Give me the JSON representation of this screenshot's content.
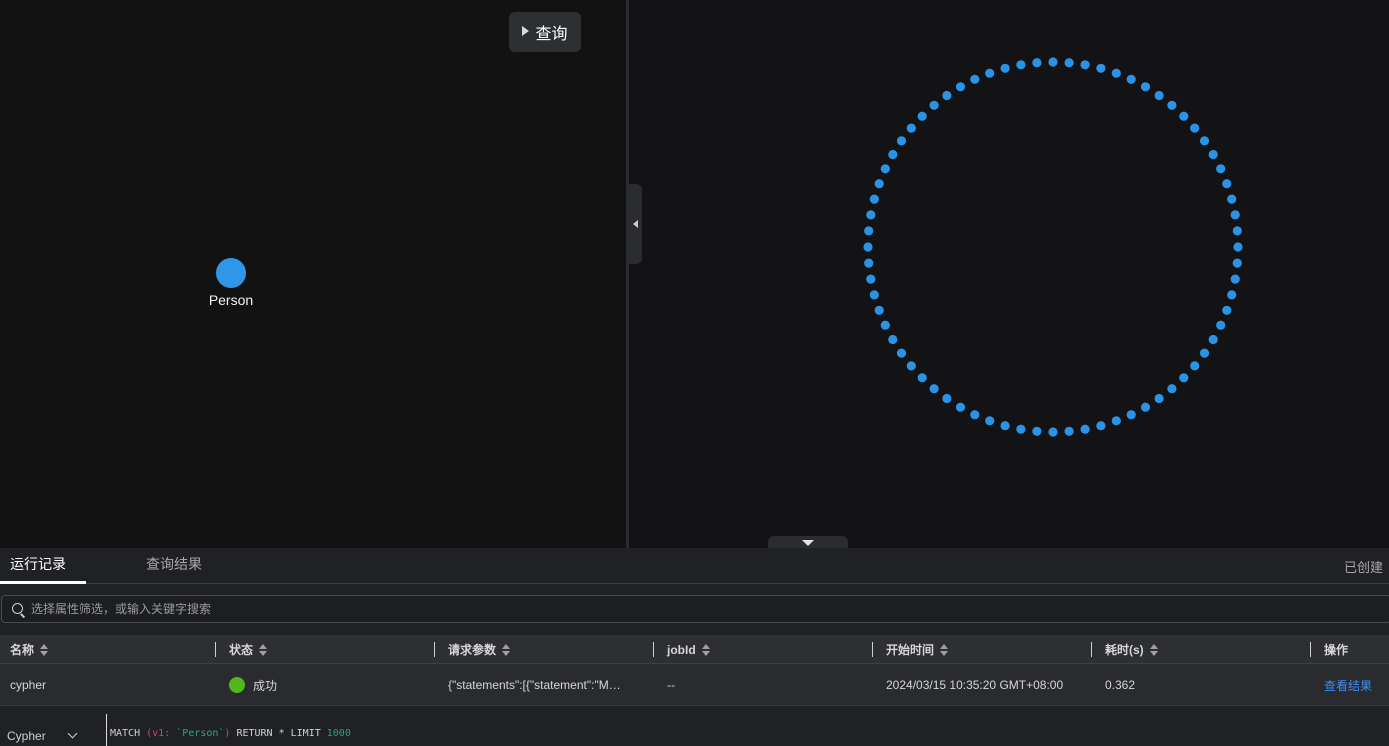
{
  "query_button": {
    "label": "查询"
  },
  "graph": {
    "node_label": "Person",
    "node_color": "#2f96e8"
  },
  "loader": {
    "dot_color": "#2a93e6"
  },
  "tabs": [
    {
      "label": "运行记录",
      "active": true
    },
    {
      "label": "查询结果",
      "active": false
    }
  ],
  "created_label": "已创建",
  "search": {
    "placeholder": "选择属性筛选，或输入关键字搜索"
  },
  "table": {
    "columns": [
      "名称",
      "状态",
      "请求参数",
      "jobId",
      "开始时间",
      "耗时(s)",
      "操作"
    ],
    "rows": [
      {
        "name": "cypher",
        "status": "成功",
        "status_color": "#52b81a",
        "params": "{\"statements\":[{\"statement\":\"M…",
        "job_id": "--",
        "start_time": "2024/03/15 10:35:20 GMT+08:00",
        "duration": "0.362",
        "action": "查看结果"
      }
    ]
  },
  "editor": {
    "language": "Cypher",
    "code_parts": {
      "p1": "MATCH ",
      "p2": "(v1: ",
      "p3": "`Person`",
      "p4": ")",
      "p5": " RETURN * LIMIT ",
      "p6": "1000"
    }
  }
}
